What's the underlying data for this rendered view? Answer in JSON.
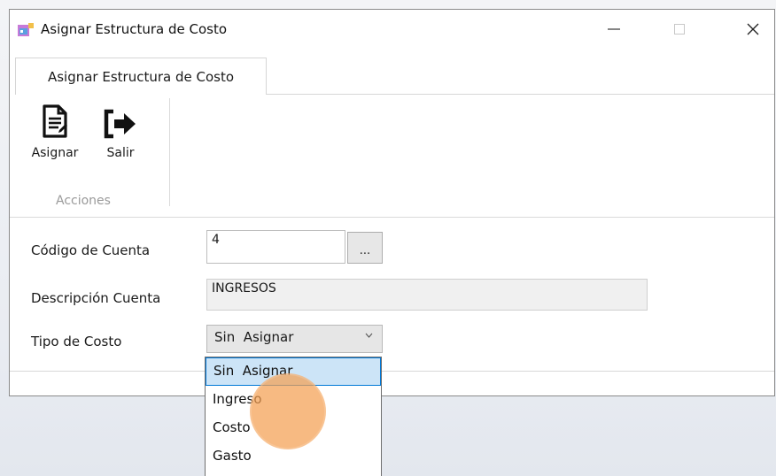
{
  "window": {
    "title": "Asignar Estructura de Costo",
    "controls": {
      "minimize": "—",
      "maximize": "☐",
      "close": "✕"
    }
  },
  "tabs": [
    {
      "label": "Asignar Estructura de Costo",
      "active": true
    }
  ],
  "ribbon": {
    "buttons": [
      {
        "label": "Asignar",
        "icon": "document-icon"
      },
      {
        "label": "Salir",
        "icon": "exit-icon"
      }
    ],
    "group_label": "Acciones"
  },
  "form": {
    "codigo_label": "Código de Cuenta",
    "codigo_value": "4",
    "lookup_label": "...",
    "descripcion_label": "Descripción Cuenta",
    "descripcion_value": "INGRESOS",
    "tipo_label": "Tipo de Costo",
    "tipo_selected": "Sin  Asignar",
    "tipo_options": [
      "Sin  Asignar",
      "Ingreso",
      "Costo",
      "Gasto"
    ]
  },
  "colors": {
    "selection_bg": "#cce4f7",
    "selection_border": "#0078d7",
    "click_indicator": "#f4a052"
  }
}
